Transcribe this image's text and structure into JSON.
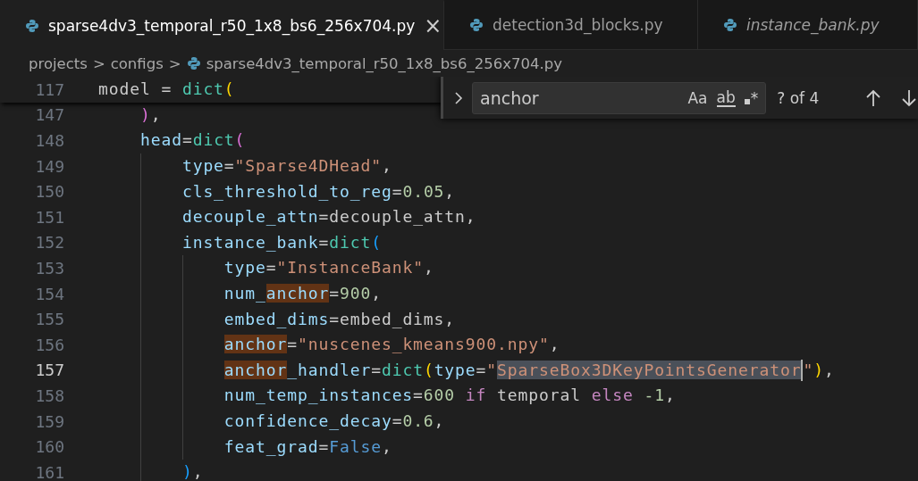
{
  "tabs": [
    {
      "label": "sparse4dv3_temporal_r50_1x8_bs6_256x704.py",
      "selected": true,
      "preview": false,
      "close": "×"
    },
    {
      "label": "detection3d_blocks.py",
      "selected": false,
      "preview": false
    },
    {
      "label": "instance_bank.py",
      "selected": false,
      "preview": true
    }
  ],
  "breadcrumb": {
    "folders": [
      "projects",
      "configs"
    ],
    "separator": ">",
    "file": "sparse4dv3_temporal_r50_1x8_bs6_256x704.py"
  },
  "sticky_line": {
    "number": "117",
    "tokens": [
      {
        "t": "model = ",
        "kind": "plain"
      },
      {
        "t": "dict",
        "kind": "function"
      },
      {
        "t": "(",
        "kind": "bracket1"
      }
    ]
  },
  "lines": [
    {
      "number": "147",
      "current": false,
      "tokens": [
        {
          "t": "    )",
          "kind": "bracket2"
        },
        {
          "t": ",",
          "kind": "plain"
        }
      ]
    },
    {
      "number": "148",
      "current": false,
      "tokens": [
        {
          "t": "    head",
          "kind": "variable"
        },
        {
          "t": "=",
          "kind": "plain"
        },
        {
          "t": "dict",
          "kind": "function"
        },
        {
          "t": "(",
          "kind": "bracket2"
        }
      ]
    },
    {
      "number": "149",
      "current": false,
      "tokens": [
        {
          "t": "        type",
          "kind": "variable"
        },
        {
          "t": "=",
          "kind": "plain"
        },
        {
          "t": "\"Sparse4DHead\"",
          "kind": "string"
        },
        {
          "t": ",",
          "kind": "plain"
        }
      ]
    },
    {
      "number": "150",
      "current": false,
      "tokens": [
        {
          "t": "        cls_threshold_to_reg",
          "kind": "variable"
        },
        {
          "t": "=",
          "kind": "plain"
        },
        {
          "t": "0.05",
          "kind": "number"
        },
        {
          "t": ",",
          "kind": "plain"
        }
      ]
    },
    {
      "number": "151",
      "current": false,
      "tokens": [
        {
          "t": "        decouple_attn",
          "kind": "variable"
        },
        {
          "t": "=decouple_attn,",
          "kind": "plain"
        }
      ]
    },
    {
      "number": "152",
      "current": false,
      "tokens": [
        {
          "t": "        instance_bank",
          "kind": "variable"
        },
        {
          "t": "=",
          "kind": "plain"
        },
        {
          "t": "dict",
          "kind": "function"
        },
        {
          "t": "(",
          "kind": "bracket3"
        }
      ]
    },
    {
      "number": "153",
      "current": false,
      "tokens": [
        {
          "t": "            type",
          "kind": "variable"
        },
        {
          "t": "=",
          "kind": "plain"
        },
        {
          "t": "\"InstanceBank\"",
          "kind": "string"
        },
        {
          "t": ",",
          "kind": "plain"
        }
      ]
    },
    {
      "number": "154",
      "current": false,
      "tokens": [
        {
          "t": "            num_",
          "kind": "variable"
        },
        {
          "t": "anchor",
          "kind": "match"
        },
        {
          "t": "=",
          "kind": "plain"
        },
        {
          "t": "900",
          "kind": "number"
        },
        {
          "t": ",",
          "kind": "plain"
        }
      ]
    },
    {
      "number": "155",
      "current": false,
      "tokens": [
        {
          "t": "            embed_dims",
          "kind": "variable"
        },
        {
          "t": "=embed_dims,",
          "kind": "plain"
        }
      ]
    },
    {
      "number": "156",
      "current": false,
      "tokens": [
        {
          "t": "            anchor",
          "kind": "match"
        },
        {
          "t": "=",
          "kind": "plain"
        },
        {
          "t": "\"nuscenes_kmeans900.npy\"",
          "kind": "string"
        },
        {
          "t": ",",
          "kind": "plain"
        }
      ]
    },
    {
      "number": "157",
      "current": true,
      "tokens": [
        {
          "t": "            anchor",
          "kind": "match"
        },
        {
          "t": "_handler",
          "kind": "variable"
        },
        {
          "t": "=",
          "kind": "plain"
        },
        {
          "t": "dict",
          "kind": "function"
        },
        {
          "t": "(",
          "kind": "bracket1"
        },
        {
          "t": "type",
          "kind": "variable"
        },
        {
          "t": "=",
          "kind": "plain"
        },
        {
          "t": "\"",
          "kind": "string"
        },
        {
          "t": "SparseBox3DKeyPointsGenerator",
          "kind": "selection"
        },
        {
          "t": "\"",
          "kind": "string",
          "cursor": true
        },
        {
          "t": ")",
          "kind": "bracket1"
        },
        {
          "t": ",",
          "kind": "plain"
        }
      ]
    },
    {
      "number": "158",
      "current": false,
      "tokens": [
        {
          "t": "            num_temp_instances",
          "kind": "variable"
        },
        {
          "t": "=",
          "kind": "plain"
        },
        {
          "t": "600 ",
          "kind": "number"
        },
        {
          "t": "if",
          "kind": "keyword"
        },
        {
          "t": " temporal ",
          "kind": "plain"
        },
        {
          "t": "else",
          "kind": "keyword"
        },
        {
          "t": " -1",
          "kind": "number"
        },
        {
          "t": ",",
          "kind": "plain"
        }
      ]
    },
    {
      "number": "159",
      "current": false,
      "tokens": [
        {
          "t": "            confidence_decay",
          "kind": "variable"
        },
        {
          "t": "=",
          "kind": "plain"
        },
        {
          "t": "0.6",
          "kind": "number"
        },
        {
          "t": ",",
          "kind": "plain"
        }
      ]
    },
    {
      "number": "160",
      "current": false,
      "tokens": [
        {
          "t": "            feat_grad",
          "kind": "variable"
        },
        {
          "t": "=",
          "kind": "plain"
        },
        {
          "t": "False",
          "kind": "constant"
        },
        {
          "t": ",",
          "kind": "plain"
        }
      ]
    },
    {
      "number": "161",
      "current": false,
      "tokens": [
        {
          "t": "        )",
          "kind": "bracket3"
        },
        {
          "t": ",",
          "kind": "plain"
        }
      ]
    }
  ],
  "find_widget": {
    "value": "anchor",
    "options": [
      "Aa",
      "ab",
      "*"
    ],
    "result": "? of 4"
  }
}
